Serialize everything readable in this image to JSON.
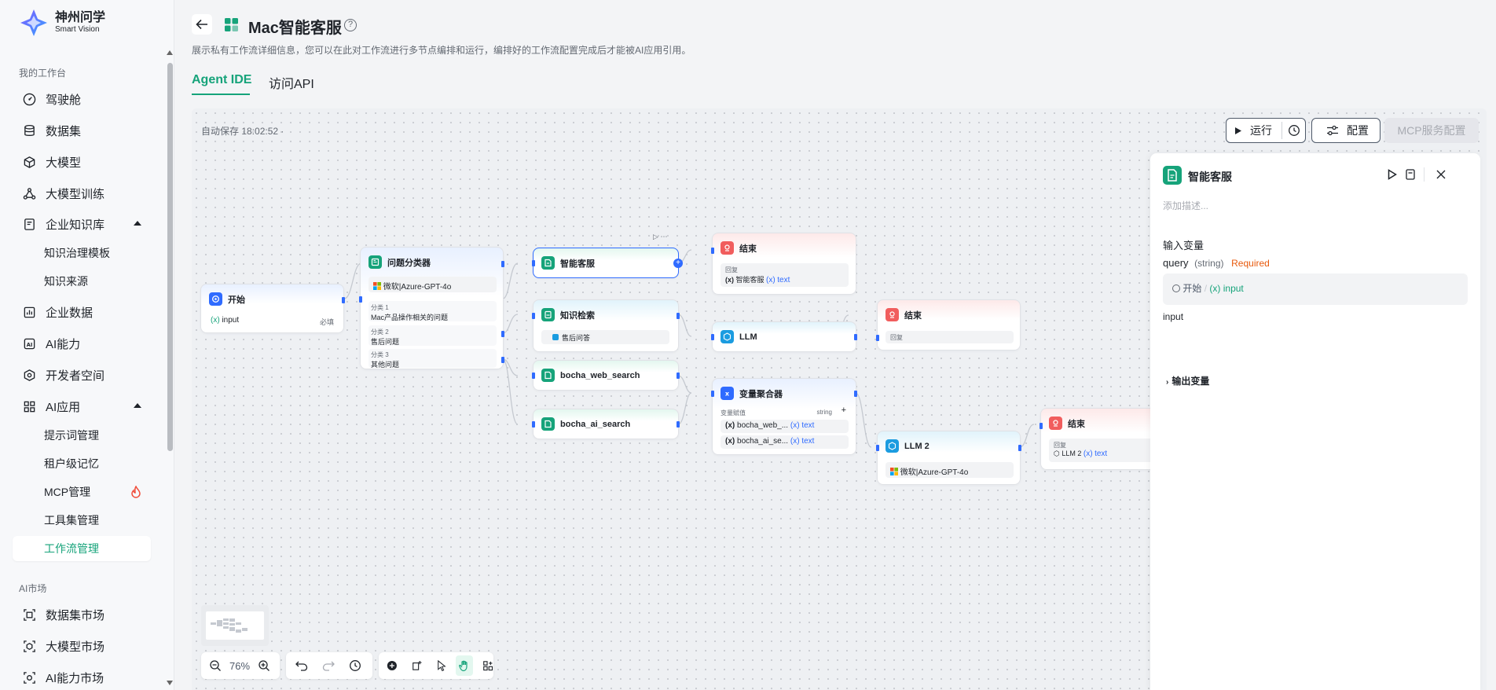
{
  "brand": {
    "name_cn": "神州问学",
    "name_en": "Smart Vision"
  },
  "sidebar": {
    "section_workspace": "我的工作台",
    "section_market": "AI市场",
    "items": [
      {
        "label": "驾驶舱",
        "icon": "dashboard-icon"
      },
      {
        "label": "数据集",
        "icon": "database-icon"
      },
      {
        "label": "大模型",
        "icon": "cube-icon"
      },
      {
        "label": "大模型训练",
        "icon": "training-icon"
      },
      {
        "label": "企业知识库",
        "icon": "book-icon"
      },
      {
        "label": "知识治理模板"
      },
      {
        "label": "知识来源"
      },
      {
        "label": "企业数据",
        "icon": "chart-icon"
      },
      {
        "label": "AI能力",
        "icon": "ai-icon"
      },
      {
        "label": "开发者空间",
        "icon": "dev-space-icon"
      },
      {
        "label": "AI应用",
        "icon": "apps-icon"
      },
      {
        "label": "提示词管理"
      },
      {
        "label": "租户级记忆"
      },
      {
        "label": "MCP管理"
      },
      {
        "label": "工具集管理"
      },
      {
        "label": "工作流管理"
      },
      {
        "label": "数据集市场",
        "icon": "dataset-market-icon"
      },
      {
        "label": "大模型市场",
        "icon": "model-market-icon"
      },
      {
        "label": "AI能力市场",
        "icon": "ai-market-icon"
      }
    ],
    "active": "工作流管理"
  },
  "header": {
    "title": "Mac智能客服",
    "description": "展示私有工作流详细信息，您可以在此对工作流进行多节点编排和运行，编排好的工作流配置完成后才能被AI应用引用。",
    "tabs": [
      "Agent IDE",
      "访问API"
    ]
  },
  "toolbar": {
    "autosave": "自动保存 18:02:52 ·",
    "run": "运行",
    "config": "配置",
    "mcp": "MCP服务配置"
  },
  "nodes": {
    "start": {
      "title": "开始",
      "var": "input",
      "required": "必填"
    },
    "classifier": {
      "title": "问题分类器",
      "model": "微软|Azure-GPT-4o",
      "classes": [
        {
          "label": "分类 1",
          "text": "Mac产品操作相关的问题"
        },
        {
          "label": "分类 2",
          "text": "售后问题"
        },
        {
          "label": "分类 3",
          "text": "其他问题"
        }
      ]
    },
    "mcp": {
      "title": "智能客服"
    },
    "end1": {
      "title": "结束",
      "reply_label": "回复",
      "src": "智能客服",
      "type": "text"
    },
    "knowledge": {
      "title": "知识检索",
      "kb": "售后问答"
    },
    "llm1": {
      "title": "LLM"
    },
    "end2": {
      "title": "结束",
      "reply_label": "回复"
    },
    "web_search": {
      "title": "bocha_web_search"
    },
    "ai_search": {
      "title": "bocha_ai_search"
    },
    "aggregator": {
      "title": "变量聚合器",
      "label": "变量赋值",
      "type_label": "string",
      "rows": [
        {
          "src": "bocha_web_...",
          "type": "text"
        },
        {
          "src": "bocha_ai_se...",
          "type": "text"
        }
      ]
    },
    "llm2": {
      "title": "LLM 2",
      "model": "微软|Azure-GPT-4o"
    },
    "end3": {
      "title": "结束",
      "reply_label": "回复",
      "src": "LLM 2",
      "type": "text"
    }
  },
  "panel": {
    "title": "智能客服",
    "desc_placeholder": "添加描述...",
    "input_section": "输入变量",
    "param_name": "query",
    "param_type": "(string)",
    "param_required": "Required",
    "ref_node": "开始",
    "ref_var": "input",
    "param_desc": "input",
    "output_section": "输出变量"
  },
  "zoom": "76%",
  "colors": {
    "accent": "#16a37a",
    "blue": "#2f6bff",
    "required": "#e8590c"
  }
}
